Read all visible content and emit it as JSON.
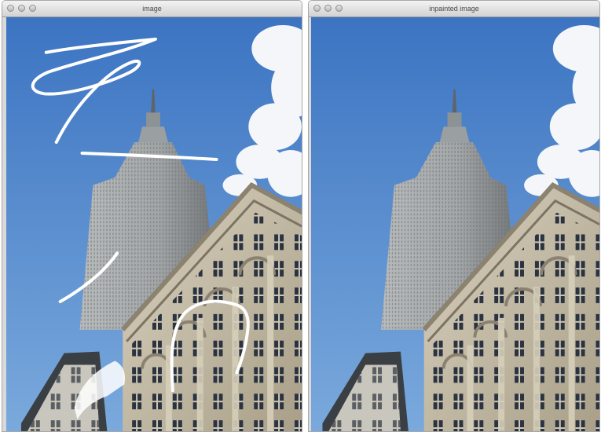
{
  "windows": {
    "left": {
      "title": "image"
    },
    "right": {
      "title": "inpainted image"
    }
  },
  "colors": {
    "sky_top": "#3f78c4",
    "sky_bottom": "#6fa1d8",
    "building_facade": "#c8c1ad",
    "tower": "#9ea3a5",
    "stroke_mask": "#ffffff"
  },
  "icons": [
    "close-button-icon",
    "minimize-button-icon",
    "zoom-button-icon"
  ]
}
